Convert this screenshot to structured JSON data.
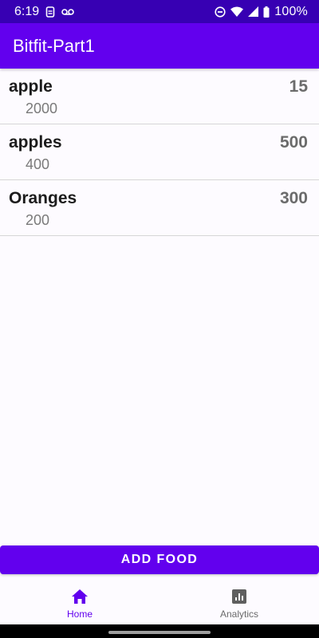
{
  "status_bar": {
    "time": "6:19",
    "battery": "100%",
    "icons": [
      "sim-card-icon",
      "voicemail-icon",
      "do-not-disturb-icon",
      "wifi-icon",
      "signal-icon",
      "battery-icon"
    ]
  },
  "app_bar": {
    "title": "Bitfit-Part1"
  },
  "food_items": [
    {
      "name": "apple",
      "sub_value": "2000",
      "calories": "15"
    },
    {
      "name": "apples",
      "sub_value": "400",
      "calories": "500"
    },
    {
      "name": "Oranges",
      "sub_value": "200",
      "calories": "300"
    }
  ],
  "add_food_label": "ADD FOOD",
  "bottom_nav": {
    "items": [
      {
        "label": "Home",
        "icon": "home-icon",
        "active": true
      },
      {
        "label": "Analytics",
        "icon": "analytics-icon",
        "active": false
      }
    ]
  },
  "colors": {
    "primary": "#6200ee",
    "primary_dark": "#3700b3",
    "background": "#fdfbff"
  }
}
